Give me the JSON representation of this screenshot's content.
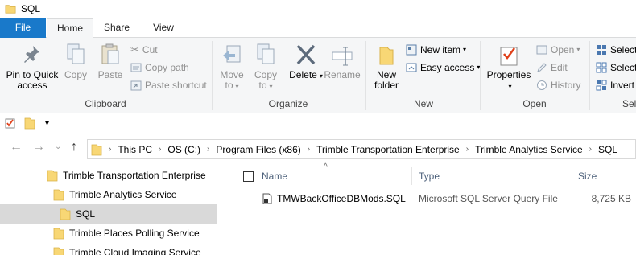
{
  "window": {
    "title": "SQL",
    "title_icon": "folder-icon"
  },
  "ribbon_tabs": {
    "file": "File",
    "home": "Home",
    "share": "Share",
    "view": "View"
  },
  "clipboard": {
    "pin_line1": "Pin to Quick",
    "pin_line2": "access",
    "copy": "Copy",
    "paste": "Paste",
    "cut": "Cut",
    "copy_path": "Copy path",
    "paste_shortcut": "Paste shortcut",
    "label": "Clipboard"
  },
  "organize": {
    "move_line1": "Move",
    "move_line2": "to",
    "copy_line1": "Copy",
    "copy_line2": "to",
    "delete": "Delete",
    "rename": "Rename",
    "label": "Organize"
  },
  "new_group": {
    "new_folder_line1": "New",
    "new_folder_line2": "folder",
    "new_item": "New item",
    "easy_access": "Easy access",
    "label": "New"
  },
  "open_group": {
    "properties": "Properties",
    "open": "Open",
    "edit": "Edit",
    "history": "History",
    "label": "Open"
  },
  "select_group": {
    "select_all": "Select",
    "select_none": "Select",
    "invert": "Invert",
    "label": "Sel"
  },
  "address": {
    "crumbs": [
      "This PC",
      "OS (C:)",
      "Program Files (x86)",
      "Trimble Transportation Enterprise",
      "Trimble Analytics Service",
      "SQL"
    ]
  },
  "tree": {
    "items": [
      "Trimble Transportation Enterprise",
      "Trimble Analytics Service",
      "SQL",
      "Trimble Places Polling Service",
      "Trimble Cloud Imaging Service"
    ]
  },
  "columns": {
    "name": "Name",
    "type": "Type",
    "size": "Size"
  },
  "files": [
    {
      "name": "TMWBackOfficeDBMods.SQL",
      "type": "Microsoft SQL Server Query File",
      "size": "8,725 KB"
    }
  ],
  "colors": {
    "accent": "#1979ca",
    "folder": "#f8d775",
    "delete_x": "#2b579a",
    "disabled": "#8f8f8f"
  }
}
